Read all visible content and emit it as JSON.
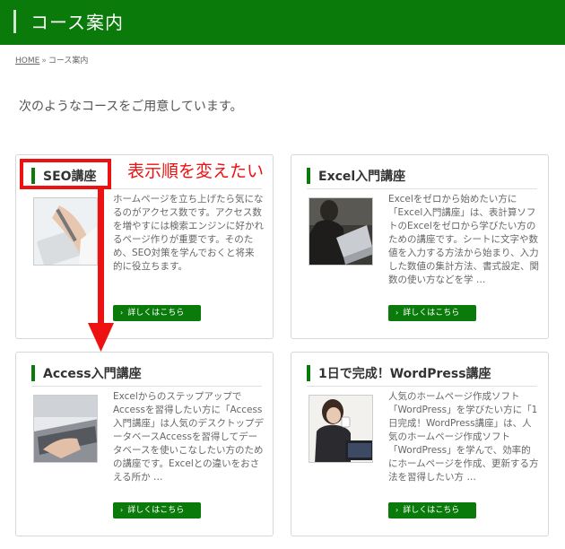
{
  "header": {
    "title": "コース案内"
  },
  "breadcrumb": {
    "home": "HOME",
    "separator": "»",
    "current": "コース案内"
  },
  "intro": "次のようなコースをご用意しています。",
  "annotation": {
    "text": "表示順を変えたい",
    "color": "#ee1111"
  },
  "colors": {
    "brand_green": "#0a7a0a",
    "annotation_red": "#ee1111"
  },
  "courses": [
    {
      "title": "SEO講座",
      "desc": "ホームページを立ち上げたら気になるのがアクセス数です。アクセス数を増やすには検索エンジンに好かれるページ作りが重要です。そのため、SEO対策を学んでおくと将来的に役立ちます。",
      "more": "詳しくはこちら",
      "image": "hand-with-tablet-photo"
    },
    {
      "title": "Excel入門講座",
      "desc": "Excelをゼロから始めたい方に「Excel入門講座」は、表計算ソフトのExcelをゼロから学びたい方のための講座です。シートに文字や数値を入力する方法から始まり、入力した数値の集計方法、書式設定、関数の使い方などを学 …",
      "more": "詳しくはこちら",
      "image": "person-with-laptop-photo"
    },
    {
      "title": "Access入門講座",
      "desc": "Excelからのステップアップで Accessを習得したい方に「Access入門講座」は人気のデスクトップデータベースAccessを習得してデータベースを使いこなしたい方のための講座です。Excelとの違いをおさえる所か …",
      "more": "詳しくはこちら",
      "image": "laptop-keyboard-photo"
    },
    {
      "title": "1日で完成！WordPress講座",
      "desc": "人気のホームページ作成ソフト「WordPress」を学びたい方に「1日完成！WordPress講座」は、人気のホームページ作成ソフト「WordPress」を学んで、効率的にホームページを作成、更新する方法を習得したい方 …",
      "more": "詳しくはこちら",
      "image": "woman-with-coffee-photo"
    }
  ]
}
